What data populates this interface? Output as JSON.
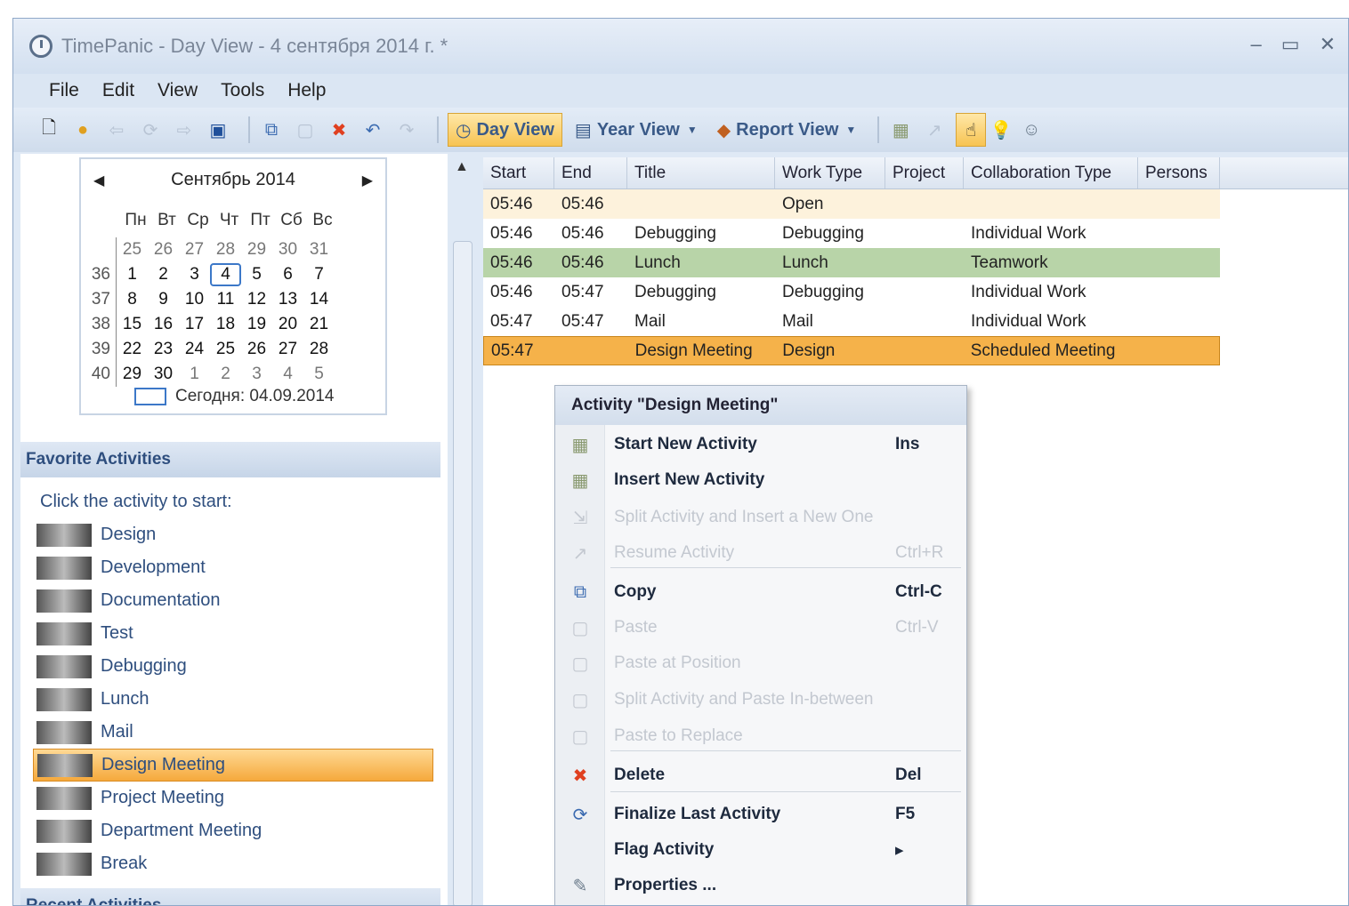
{
  "window": {
    "title": "TimePanic - Day View - 4 сентября 2014 г. *",
    "controls": [
      "–",
      "▭",
      "✕"
    ]
  },
  "menu": [
    "File",
    "Edit",
    "View",
    "Tools",
    "Help"
  ],
  "toolbar": {
    "day_view": "Day View",
    "year_view": "Year View",
    "report_view": "Report View"
  },
  "calendar": {
    "month": "Сентябрь 2014",
    "weekdays": [
      "Пн",
      "Вт",
      "Ср",
      "Чт",
      "Пт",
      "Сб",
      "Вс"
    ],
    "weeks": [
      {
        "num": "",
        "days": [
          "25",
          "26",
          "27",
          "28",
          "29",
          "30",
          "31"
        ]
      },
      {
        "num": "36",
        "days": [
          "1",
          "2",
          "3",
          "4",
          "5",
          "6",
          "7"
        ]
      },
      {
        "num": "37",
        "days": [
          "8",
          "9",
          "10",
          "11",
          "12",
          "13",
          "14"
        ]
      },
      {
        "num": "38",
        "days": [
          "15",
          "16",
          "17",
          "18",
          "19",
          "20",
          "21"
        ]
      },
      {
        "num": "39",
        "days": [
          "22",
          "23",
          "24",
          "25",
          "26",
          "27",
          "28"
        ]
      },
      {
        "num": "40",
        "days": [
          "29",
          "30",
          "1",
          "2",
          "3",
          "4",
          "5"
        ]
      }
    ],
    "today": "Сегодня: 04.09.2014"
  },
  "favorites": {
    "header": "Favorite Activities",
    "hint": "Click the activity to start:",
    "items": [
      "Design",
      "Development",
      "Documentation",
      "Test",
      "Debugging",
      "Lunch",
      "Mail",
      "Design Meeting",
      "Project Meeting",
      "Department Meeting",
      "Break"
    ]
  },
  "recent": {
    "header": "Recent Activities"
  },
  "grid": {
    "columns": [
      "Start",
      "End",
      "Title",
      "Work Type",
      "Project",
      "Collaboration Type",
      "Persons"
    ],
    "rows": [
      {
        "start": "05:46",
        "end": "05:46",
        "title": "",
        "work_type": "Open",
        "project": "",
        "collab": "",
        "persons": ""
      },
      {
        "start": "05:46",
        "end": "05:46",
        "title": "Debugging",
        "work_type": "Debugging",
        "project": "",
        "collab": "Individual Work",
        "persons": ""
      },
      {
        "start": "05:46",
        "end": "05:46",
        "title": "Lunch",
        "work_type": "Lunch",
        "project": "",
        "collab": "Teamwork",
        "persons": ""
      },
      {
        "start": "05:46",
        "end": "05:47",
        "title": "Debugging",
        "work_type": "Debugging",
        "project": "",
        "collab": "Individual Work",
        "persons": ""
      },
      {
        "start": "05:47",
        "end": "05:47",
        "title": "Mail",
        "work_type": "Mail",
        "project": "",
        "collab": "Individual Work",
        "persons": ""
      },
      {
        "start": "05:47",
        "end": "",
        "title": "Design Meeting",
        "work_type": "Design",
        "project": "",
        "collab": "Scheduled Meeting",
        "persons": ""
      }
    ]
  },
  "context_menu": {
    "title": "Activity \"Design Meeting\"",
    "items": [
      {
        "label": "Start New Activity",
        "shortcut": "Ins"
      },
      {
        "label": "Insert New Activity",
        "shortcut": ""
      },
      {
        "label": "Split Activity and Insert a New One",
        "shortcut": ""
      },
      {
        "label": "Resume Activity",
        "shortcut": "Ctrl+R"
      },
      {
        "label": "Copy",
        "shortcut": "Ctrl-C"
      },
      {
        "label": "Paste",
        "shortcut": "Ctrl-V"
      },
      {
        "label": "Paste at Position",
        "shortcut": ""
      },
      {
        "label": "Split Activity and Paste In-between",
        "shortcut": ""
      },
      {
        "label": "Paste to Replace",
        "shortcut": ""
      },
      {
        "label": "Delete",
        "shortcut": "Del"
      },
      {
        "label": "Finalize Last Activity",
        "shortcut": "F5"
      },
      {
        "label": "Flag Activity",
        "shortcut": "▸"
      },
      {
        "label": "Properties ...",
        "shortcut": ""
      }
    ]
  },
  "colors": {
    "selection": "#f5b24a",
    "green_row": "#b8d4a8",
    "open_row": "#fdf2dc",
    "header_text": "#2e4e7e"
  }
}
